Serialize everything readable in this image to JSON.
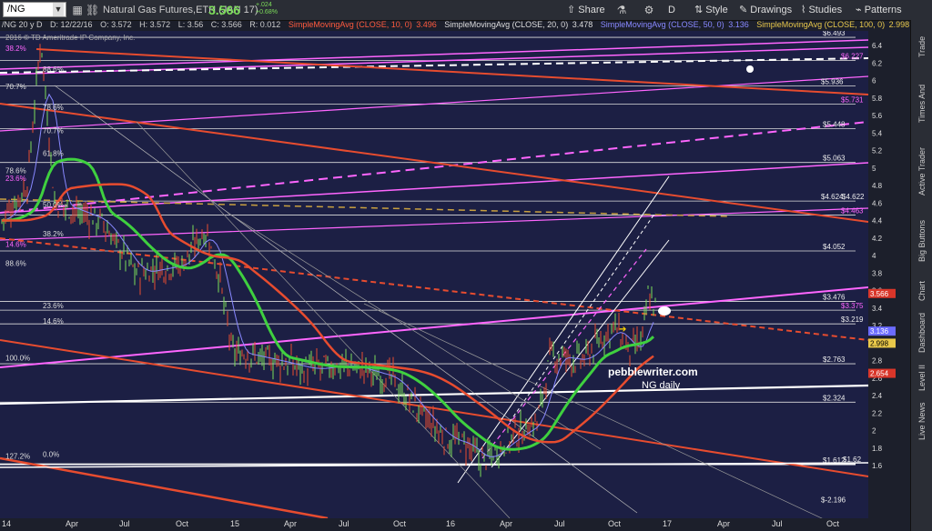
{
  "toolbar": {
    "symbol": "/NG",
    "security_name": "Natural Gas Futures,ETH (JAN 17)",
    "last_price": "3.566",
    "change_1": "+.024",
    "change_2": "+0.68%",
    "share_label": "Share",
    "interval_label": "D",
    "style_label": "Style",
    "drawings_label": "Drawings",
    "studies_label": "Studies",
    "patterns_label": "Patterns"
  },
  "infobar": {
    "description": "/NG 20 y D",
    "date": "D: 12/22/16",
    "open": "O: 3.572",
    "high": "H: 3.572",
    "low": "L: 3.56",
    "close": "C: 3.566",
    "range": "R: 0.012",
    "sma10_label": "SimpleMovingAvg (CLOSE, 10, 0)",
    "sma10_val": "3.496",
    "sma20_label": "SimpleMovingAvg (CLOSE, 20, 0)",
    "sma20_val": "3.478",
    "sma50_label": "SimpleMovingAvg (CLOSE, 50, 0)",
    "sma50_val": "3.136",
    "sma100_label": "SimpleMovingAvg (CLOSE, 100, 0)",
    "sma100_val": "2.998"
  },
  "chart": {
    "copyright": "2016 © TD Ameritrade IP Company, Inc.",
    "watermark_1": "pebblewriter.com",
    "watermark_2": "NG daily",
    "fib_left": [
      "100.0%",
      "38.2%",
      "88.6%",
      "70.7%",
      "78.6%",
      "70.7%",
      "61.8%",
      "78.6%",
      "23.6%",
      "50.0%",
      "38.2%",
      "14.6%",
      "88.6%",
      "23.6%",
      "14.6%",
      "100.0%",
      "0.0%",
      "127.2%"
    ],
    "fib_right": [
      "$6.493",
      "$6.227",
      "$5.936",
      "$5.731",
      "$5.448",
      "$5.063",
      "$4.622",
      "$4.624",
      "$4.463",
      "$4.052",
      "$3.476",
      "$3.375",
      "$3.219",
      "$2.763",
      "$2.324",
      "$1.62",
      "$1.612",
      "$-2.196"
    ],
    "price_axis": [
      "6.4",
      "6.2",
      "6",
      "5.8",
      "5.6",
      "5.4",
      "5.2",
      "5",
      "4.8",
      "4.6",
      "4.4",
      "4.2",
      "4",
      "3.8",
      "3.6",
      "3.4",
      "3.2",
      "3",
      "2.8",
      "2.6",
      "2.4",
      "2.2",
      "2",
      "1.8",
      "1.6"
    ],
    "tags": {
      "last": "3.566",
      "sma50": "3.136",
      "sma100": "2.998",
      "sma200": "2.654"
    },
    "x_axis": [
      "14",
      "Apr",
      "Jul",
      "Oct",
      "15",
      "Apr",
      "Jul",
      "Oct",
      "16",
      "Apr",
      "Jul",
      "Oct",
      "17",
      "Apr",
      "Jul",
      "Oct"
    ]
  },
  "sidebar": [
    "Trade",
    "Times And Sales",
    "Active Trader",
    "Big Buttons",
    "Chart",
    "Dashboard",
    "Level II",
    "Live News"
  ],
  "colors": {
    "up": "#7cdc5a",
    "sma10": "#ff5a3c",
    "sma20": "#8888ff",
    "sma50": "#3fd03f",
    "sma100": "#ff5a3c",
    "fib": "#ffffff",
    "pink": "#ff66ff"
  }
}
